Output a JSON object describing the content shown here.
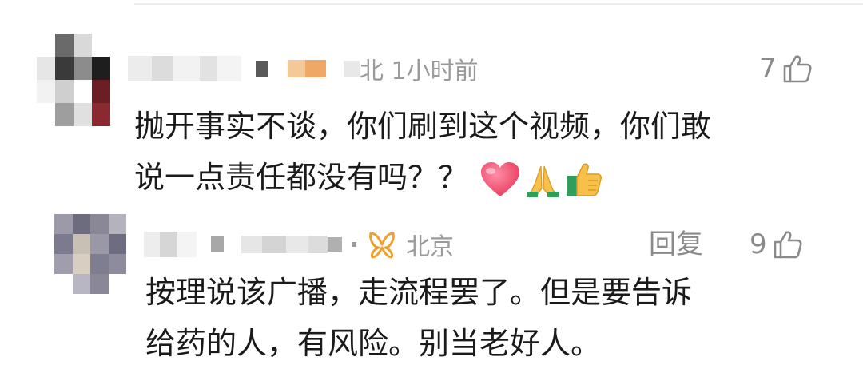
{
  "comments": [
    {
      "location_time": "北 1小时前",
      "likes": "7",
      "text_line1": "抛开事实不谈，你们刷到这个视频，你们敢",
      "text_line2": "说一点责任都没有吗？？",
      "emojis": [
        "heart-emoji",
        "praying-hands-emoji",
        "thumbs-up-emoji"
      ]
    },
    {
      "location": "北京",
      "reply_label": "回复",
      "likes": "9",
      "text_line1": "按理说该广播，走流程罢了。但是要告诉",
      "text_line2": "给药的人，有风险。别当老好人。",
      "badge_color": "#f0a030"
    }
  ],
  "colors": {
    "text": "#1a1a1a",
    "meta": "#9a9a9a",
    "like": "#8a8a8a",
    "heart": "#f0506e",
    "thumb": "#f5b320"
  }
}
